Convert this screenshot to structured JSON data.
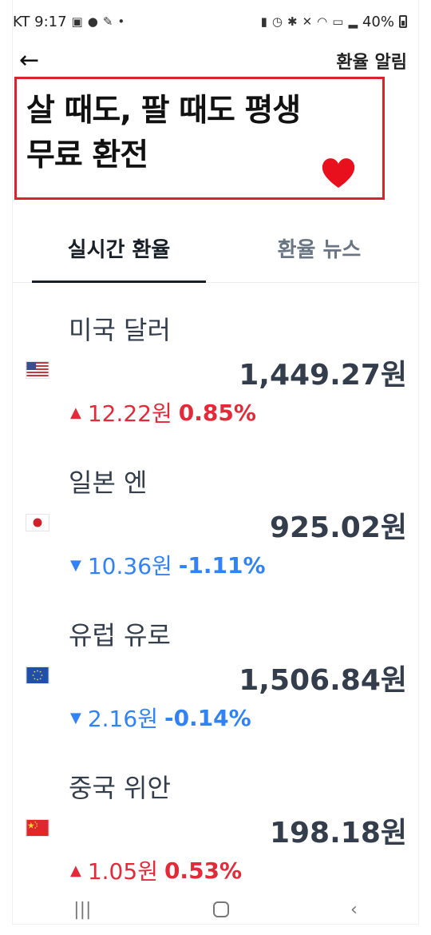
{
  "status_bar": {
    "carrier_time": "KT 9:17",
    "battery": "40%"
  },
  "header": {
    "action_label": "환율 알림"
  },
  "headline": {
    "line1": "살 때도, 팔 때도 평생",
    "line2": "무료 환전"
  },
  "tabs": [
    {
      "label": "실시간 환율",
      "active": true
    },
    {
      "label": "환율 뉴스",
      "active": false
    }
  ],
  "currencies": [
    {
      "name": "미국 달러",
      "rate": "1,449.27원",
      "direction": "up",
      "change": "12.22원",
      "percent": "0.85%"
    },
    {
      "name": "일본 엔",
      "rate": "925.02원",
      "direction": "down",
      "change": "10.36원",
      "percent": "-1.11%"
    },
    {
      "name": "유럽 유로",
      "rate": "1,506.84원",
      "direction": "down",
      "change": "2.16원",
      "percent": "-0.14%"
    },
    {
      "name": "중국 위안",
      "rate": "198.18원",
      "direction": "up",
      "change": "1.05원",
      "percent": "0.53%"
    }
  ],
  "colors": {
    "up": "#e42939",
    "down": "#3182f6",
    "highlight_border": "#d9232d"
  }
}
